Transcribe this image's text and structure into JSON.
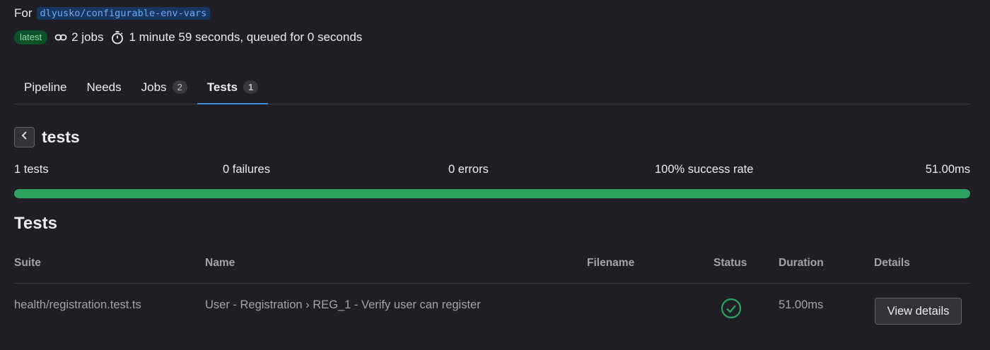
{
  "header": {
    "for_label": "For",
    "ref": "dlyusko/configurable-env-vars",
    "badge": "latest",
    "jobs": "2 jobs",
    "duration": "1 minute 59 seconds, queued for 0 seconds"
  },
  "tabs": [
    {
      "label": "Pipeline",
      "count": null
    },
    {
      "label": "Needs",
      "count": null
    },
    {
      "label": "Jobs",
      "count": "2"
    },
    {
      "label": "Tests",
      "count": "1",
      "active": true
    }
  ],
  "suite": {
    "title": "tests",
    "summary": {
      "tests": "1 tests",
      "failures": "0 failures",
      "errors": "0 errors",
      "success_rate": "100% success rate",
      "duration": "51.00ms"
    },
    "progress_percent": 100
  },
  "tests_section": {
    "heading": "Tests",
    "columns": {
      "suite": "Suite",
      "name": "Name",
      "filename": "Filename",
      "status": "Status",
      "duration": "Duration",
      "details": "Details"
    },
    "rows": [
      {
        "suite": "health/registration.test.ts",
        "name": "User - Registration › REG_1 - Verify user can register",
        "filename": "",
        "status": "success",
        "duration": "51.00ms",
        "action": "View details"
      }
    ]
  },
  "colors": {
    "background": "#1f1e24",
    "success": "#2da160",
    "accent": "#428fdc",
    "badge_bg": "#0d532a"
  },
  "icons": {
    "jobs": "link-icon",
    "duration": "stopwatch-icon",
    "back": "chevron-left-icon",
    "status": "check-circle-icon"
  }
}
